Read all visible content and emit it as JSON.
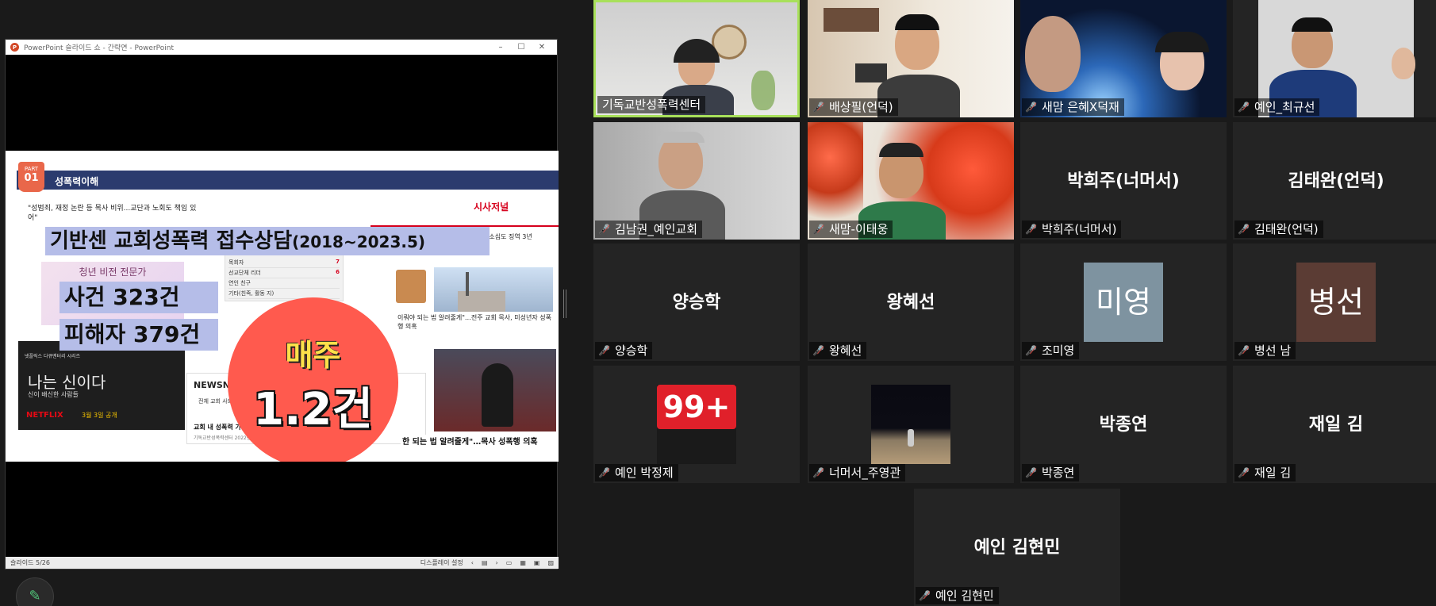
{
  "powerpoint": {
    "title": "PowerPoint 슬라이드 쇼 - 간략연 - PowerPoint",
    "status_slide": "슬라이드 5/26",
    "status_display": "디스플레이 설정"
  },
  "slide": {
    "part_label": "PART",
    "part_number": "01",
    "header_title": "성폭력이해",
    "small_headline": "\"성범죄, 재정 논란 등 목사 비위...교단과 노회도 책임 있어\"",
    "brand": "시사저널",
    "right_snippet": "향소심도 징역 3년",
    "main_title": "기반센 교회성폭력 접수상담",
    "main_title_period": "(2018~2023.5)",
    "cases": "사건  323건",
    "victims": "피해자  379건",
    "poster_text": "청년 비전 전문가",
    "list_items": [
      "목회자",
      "선교단체 리더",
      "연인 친구",
      "기타(친족, 활동 지)"
    ],
    "list_values": [
      "7",
      "6"
    ],
    "netflix_title": "나는 신이다",
    "netflix_sub": "신이 배신한 사람들",
    "netflix_logo": "NETFLIX",
    "netflix_date": "3월 3일 공개",
    "netflix_strip": "넷플릭스 다큐멘터리 시리즈",
    "newsjoy_logo": "NEWSNJOY",
    "newsjoy_menu": "전체  교회  사회  기획",
    "newsjoy_headline": "교회 내 성폭력 가해자 71.5%는 목",
    "newsjoy_sub": "기독교반성폭력센터 2022년 상담 통계",
    "news_line": "이뤄야 되는 법 알려줄게\"…전주 교회 목사, 미성년자 성폭행 의혹",
    "caption": "한 되는 법 알려줄게\"…목사 성폭행 의혹",
    "weekly": "매주",
    "weekly_value": "1.2건"
  },
  "participants": [
    {
      "name": "기독교반성폭력센터",
      "muted": false,
      "video": true,
      "active": true
    },
    {
      "name": "배상필(언덕)",
      "muted": true,
      "video": true
    },
    {
      "name": "새맘 은혜X덕재",
      "muted": true,
      "video": true
    },
    {
      "name": "예인_최규선",
      "muted": true,
      "video": true
    },
    {
      "name": "김남권_예인교회",
      "muted": true,
      "video": true
    },
    {
      "name": "새맘-이태웅",
      "muted": true,
      "video": true
    },
    {
      "name": "박희주(너머서)",
      "display": "박희주(너머서)",
      "muted": true,
      "video": false
    },
    {
      "name": "김태완(언덕)",
      "display": "김태완(언덕)",
      "muted": true,
      "video": false
    },
    {
      "name": "양승학",
      "display": "양승학",
      "muted": true,
      "video": false
    },
    {
      "name": "왕혜선",
      "display": "왕혜선",
      "muted": true,
      "video": false
    },
    {
      "name": "조미영",
      "avatar": "미영",
      "avatar_color": "#7e93a0",
      "muted": true,
      "video": false
    },
    {
      "name": "병선 남",
      "avatar": "병선",
      "avatar_color": "#5b3c34",
      "muted": true,
      "video": false
    },
    {
      "name": "예인 박정제",
      "badge": "99+",
      "muted": true,
      "video": false
    },
    {
      "name": "너머서_주영관",
      "muted": true,
      "video": false
    },
    {
      "name": "박종연",
      "display": "박종연",
      "muted": true,
      "video": false
    },
    {
      "name": "재일 김",
      "display": "재일 김",
      "muted": true,
      "video": false
    },
    {
      "name": "예인 김현민",
      "display": "예인 김현민",
      "muted": true,
      "video": false
    }
  ],
  "colors": {
    "active_speaker": "#a8e05a",
    "muted_icon": "#e0433b",
    "tile_bg": "#242424",
    "app_bg": "#1a1a1a"
  },
  "icons": [
    "mic-muted-icon",
    "pen-icon",
    "minimize-icon",
    "maximize-icon",
    "close-icon"
  ]
}
